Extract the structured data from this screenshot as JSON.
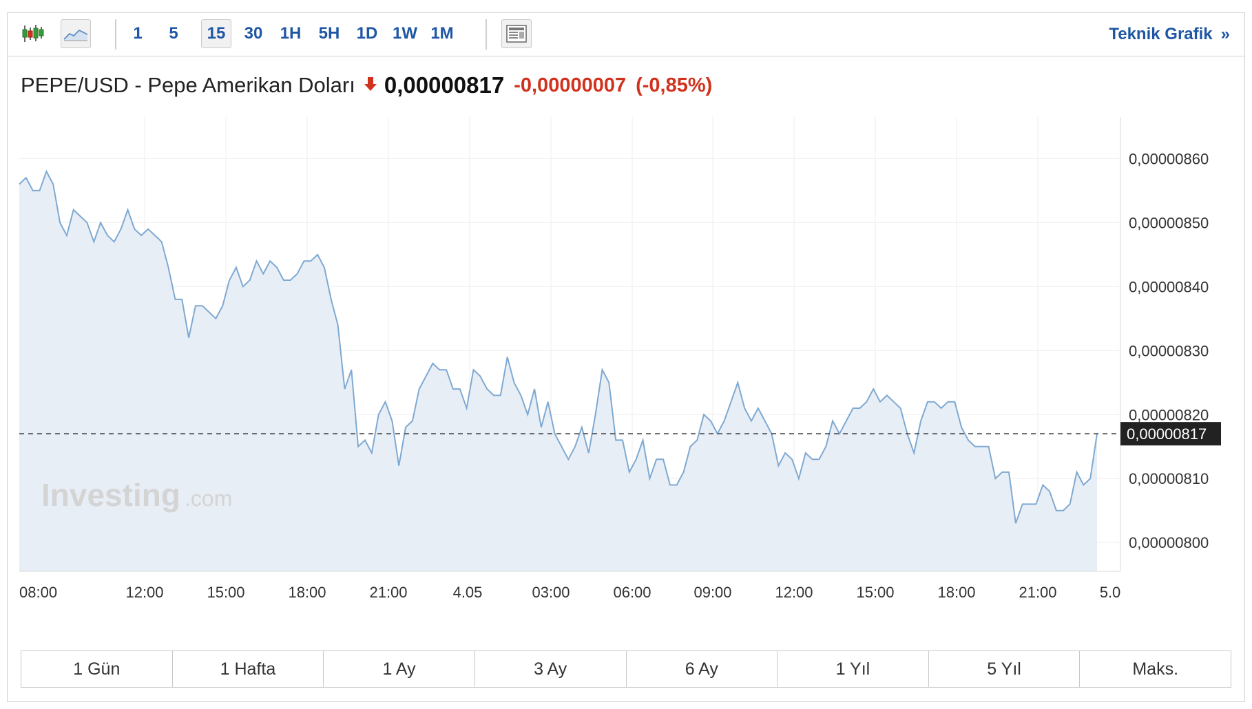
{
  "toolbar": {
    "intervals": [
      "1",
      "5",
      "15",
      "30",
      "1H",
      "5H",
      "1D",
      "1W",
      "1M"
    ],
    "active_interval": "15",
    "teknik_label": "Teknik Grafik",
    "teknik_chevron": "»",
    "icons": [
      "candlestick-icon",
      "area-chart-icon",
      "news-panel-icon"
    ]
  },
  "header": {
    "pair": "PEPE/USD - Pepe Amerikan Doları",
    "direction_icon": "down-arrow-icon",
    "price": "0,00000817",
    "change": "-0,00000007",
    "change_pct": "(-0,85%)",
    "down_color": "#d0321e"
  },
  "watermark": {
    "brand": "Investing",
    "suffix": ".com"
  },
  "chart_data": {
    "type": "area",
    "ylim": [
      7.955e-06,
      8.665e-06
    ],
    "yticks": [
      8e-06,
      8.1e-06,
      8.2e-06,
      8.3e-06,
      8.4e-06,
      8.5e-06,
      8.6e-06
    ],
    "ytick_labels": [
      "0,00000800",
      "0,00000810",
      "0,00000820",
      "0,00000830",
      "0,00000840",
      "0,00000850",
      "0,00000860"
    ],
    "xtick_labels": [
      "08:00",
      "12:00",
      "15:00",
      "18:00",
      "21:00",
      "4.05",
      "03:00",
      "06:00",
      "09:00",
      "12:00",
      "15:00",
      "18:00",
      "21:00",
      "5.0"
    ],
    "xlabel": "",
    "ylabel": "",
    "last_value": 8.17e-06,
    "last_value_label": "0,00000817",
    "line_color": "#7ea9d2",
    "fill_color": "#e8eef6",
    "grid": true,
    "series": [
      {
        "values": [
          8.56e-06,
          8.57e-06,
          8.55e-06,
          8.55e-06,
          8.58e-06,
          8.56e-06,
          8.5e-06,
          8.48e-06,
          8.52e-06,
          8.51e-06,
          8.5e-06,
          8.47e-06,
          8.5e-06,
          8.48e-06,
          8.47e-06,
          8.49e-06,
          8.52e-06,
          8.49e-06,
          8.48e-06,
          8.49e-06,
          8.48e-06,
          8.47e-06,
          8.43e-06,
          8.38e-06,
          8.38e-06,
          8.32e-06,
          8.37e-06,
          8.37e-06,
          8.36e-06,
          8.35e-06,
          8.37e-06,
          8.41e-06,
          8.43e-06,
          8.4e-06,
          8.41e-06,
          8.44e-06,
          8.42e-06,
          8.44e-06,
          8.43e-06,
          8.41e-06,
          8.41e-06,
          8.42e-06,
          8.44e-06,
          8.44e-06,
          8.45e-06,
          8.43e-06,
          8.38e-06,
          8.34e-06,
          8.24e-06,
          8.27e-06,
          8.15e-06,
          8.16e-06,
          8.14e-06,
          8.2e-06,
          8.22e-06,
          8.19e-06,
          8.12e-06,
          8.18e-06,
          8.19e-06,
          8.24e-06,
          8.26e-06,
          8.28e-06,
          8.27e-06,
          8.27e-06,
          8.24e-06,
          8.24e-06,
          8.21e-06,
          8.27e-06,
          8.26e-06,
          8.24e-06,
          8.23e-06,
          8.23e-06,
          8.29e-06,
          8.25e-06,
          8.23e-06,
          8.2e-06,
          8.24e-06,
          8.18e-06,
          8.22e-06,
          8.17e-06,
          8.15e-06,
          8.13e-06,
          8.15e-06,
          8.18e-06,
          8.14e-06,
          8.2e-06,
          8.27e-06,
          8.25e-06,
          8.16e-06,
          8.16e-06,
          8.11e-06,
          8.13e-06,
          8.16e-06,
          8.1e-06,
          8.13e-06,
          8.13e-06,
          8.09e-06,
          8.09e-06,
          8.11e-06,
          8.15e-06,
          8.16e-06,
          8.2e-06,
          8.19e-06,
          8.17e-06,
          8.19e-06,
          8.22e-06,
          8.25e-06,
          8.21e-06,
          8.19e-06,
          8.21e-06,
          8.19e-06,
          8.17e-06,
          8.12e-06,
          8.14e-06,
          8.13e-06,
          8.1e-06,
          8.14e-06,
          8.13e-06,
          8.13e-06,
          8.15e-06,
          8.19e-06,
          8.17e-06,
          8.19e-06,
          8.21e-06,
          8.21e-06,
          8.22e-06,
          8.24e-06,
          8.22e-06,
          8.23e-06,
          8.22e-06,
          8.21e-06,
          8.17e-06,
          8.14e-06,
          8.19e-06,
          8.22e-06,
          8.22e-06,
          8.21e-06,
          8.22e-06,
          8.22e-06,
          8.18e-06,
          8.16e-06,
          8.15e-06,
          8.15e-06,
          8.15e-06,
          8.1e-06,
          8.11e-06,
          8.11e-06,
          8.03e-06,
          8.06e-06,
          8.06e-06,
          8.06e-06,
          8.09e-06,
          8.08e-06,
          8.05e-06,
          8.05e-06,
          8.06e-06,
          8.11e-06,
          8.09e-06,
          8.1e-06,
          8.17e-06
        ]
      }
    ]
  },
  "ranges": [
    "1 Gün",
    "1 Hafta",
    "1 Ay",
    "3 Ay",
    "6 Ay",
    "1 Yıl",
    "5 Yıl",
    "Maks."
  ]
}
